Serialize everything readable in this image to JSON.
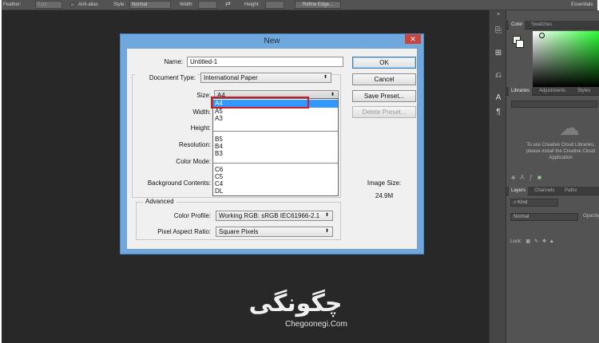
{
  "options_bar": {
    "feather_label": "Feather:",
    "feather_value": "0 px",
    "anti_alias_label": "Anti-alias",
    "style_label": "Style:",
    "style_value": "Normal",
    "width_label": "Width:",
    "height_label": "Height:",
    "refine_edge_label": "Refine Edge...",
    "workspace_label": "Essentials"
  },
  "panels": {
    "color_tabs": [
      "Color",
      "Swatches"
    ],
    "library_tabs": [
      "Libraries",
      "Adjustments",
      "Styles"
    ],
    "cc_message": "To use Creative Cloud Libraries, please install the Creative Cloud Application",
    "layers_tabs": [
      "Layers",
      "Channels",
      "Paths"
    ],
    "kind_label": "Kind",
    "blend_mode": "Normal",
    "opacity_label": "Opacity:",
    "lock_label": "Lock:"
  },
  "dialog": {
    "title": "New",
    "close_glyph": "✕",
    "name_label": "Name:",
    "name_value": "Untitled-1",
    "doc_type_label": "Document Type:",
    "doc_type_value": "International Paper",
    "size_label": "Size:",
    "size_value": "A4",
    "width_label": "Width:",
    "height_label": "Height:",
    "resolution_label": "Resolution:",
    "color_mode_label": "Color Mode:",
    "bg_contents_label": "Background Contents:",
    "advanced_label": "Advanced",
    "color_profile_label": "Color Profile:",
    "color_profile_value": "Working RGB:  sRGB IEC61966-2.1",
    "pixel_aspect_label": "Pixel Aspect Ratio:",
    "pixel_aspect_value": "Square Pixels",
    "ok_label": "OK",
    "cancel_label": "Cancel",
    "save_preset_label": "Save Preset...",
    "delete_preset_label": "Delete Preset...",
    "image_size_label": "Image Size:",
    "image_size_value": "24.9M",
    "size_options": [
      "A4",
      "A5",
      "A3",
      "B5",
      "B4",
      "B3",
      "C6",
      "C5",
      "C4",
      "DL"
    ],
    "selected_size": "A4"
  },
  "watermark": {
    "fa_text": "چگونگی",
    "en_text": "Chegoonegi.Com"
  }
}
